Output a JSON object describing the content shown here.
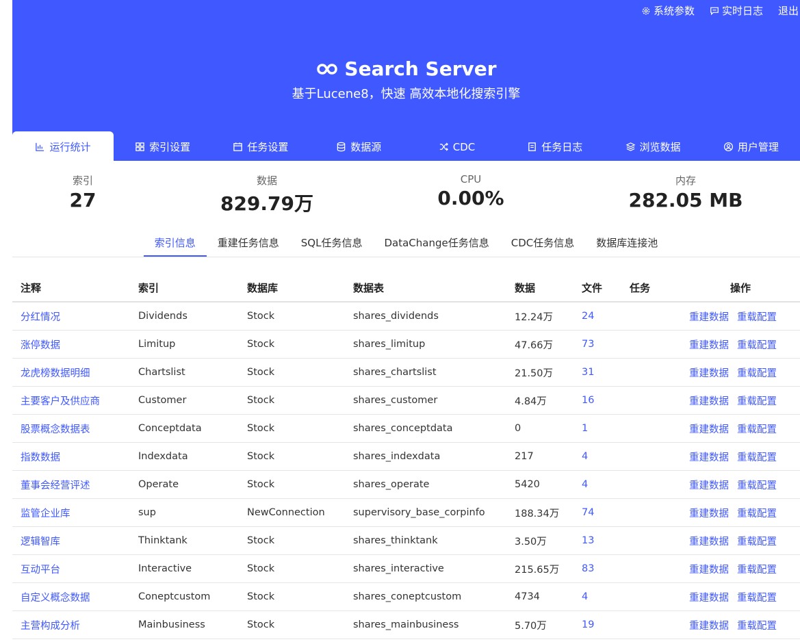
{
  "header": {
    "links": [
      {
        "label": "系统参数",
        "icon": "gear-icon"
      },
      {
        "label": "实时日志",
        "icon": "message-icon"
      },
      {
        "label": "退出"
      }
    ],
    "title": "Search Server",
    "subtitle": "基于Lucene8，快速 高效本地化搜索引擎",
    "accent": "#3f58ff"
  },
  "tabs": [
    {
      "label": "运行统计",
      "icon": "chart-icon"
    },
    {
      "label": "索引设置",
      "icon": "grid-icon"
    },
    {
      "label": "任务设置",
      "icon": "calendar-icon"
    },
    {
      "label": "数据源",
      "icon": "database-icon"
    },
    {
      "label": "CDC",
      "icon": "shuffle-icon"
    },
    {
      "label": "任务日志",
      "icon": "log-icon"
    },
    {
      "label": "浏览数据",
      "icon": "layers-icon"
    },
    {
      "label": "用户管理",
      "icon": "user-icon"
    }
  ],
  "stats": [
    {
      "label": "索引",
      "value": "27"
    },
    {
      "label": "数据",
      "value": "829.79万"
    },
    {
      "label": "CPU",
      "value": "0.00%"
    },
    {
      "label": "内存",
      "value": "282.05 MB"
    }
  ],
  "subtabs": [
    "索引信息",
    "重建任务信息",
    "SQL任务信息",
    "DataChange任务信息",
    "CDC任务信息",
    "数据库连接池"
  ],
  "table": {
    "headers": [
      "注释",
      "索引",
      "数据库",
      "数据表",
      "数据",
      "文件",
      "任务",
      "操作"
    ],
    "action_rebuild": "重建数据",
    "action_reload": "重载配置",
    "rows": [
      {
        "note": "分红情况",
        "index": "Dividends",
        "db": "Stock",
        "table": "shares_dividends",
        "data": "12.24万",
        "files": "24",
        "task": ""
      },
      {
        "note": "涨停数据",
        "index": "Limitup",
        "db": "Stock",
        "table": "shares_limitup",
        "data": "47.66万",
        "files": "73",
        "task": ""
      },
      {
        "note": "龙虎榜数据明细",
        "index": "Chartslist",
        "db": "Stock",
        "table": "shares_chartslist",
        "data": "21.50万",
        "files": "31",
        "task": ""
      },
      {
        "note": "主要客户及供应商",
        "index": "Customer",
        "db": "Stock",
        "table": "shares_customer",
        "data": "4.84万",
        "files": "16",
        "task": ""
      },
      {
        "note": "股票概念数据表",
        "index": "Conceptdata",
        "db": "Stock",
        "table": "shares_conceptdata",
        "data": "0",
        "files": "1",
        "task": ""
      },
      {
        "note": "指数数据",
        "index": "Indexdata",
        "db": "Stock",
        "table": "shares_indexdata",
        "data": "217",
        "files": "4",
        "task": ""
      },
      {
        "note": "董事会经营评述",
        "index": "Operate",
        "db": "Stock",
        "table": "shares_operate",
        "data": "5420",
        "files": "4",
        "task": ""
      },
      {
        "note": "监管企业库",
        "index": "sup",
        "db": "NewConnection",
        "table": "supervisory_base_corpinfo",
        "data": "188.34万",
        "files": "74",
        "task": ""
      },
      {
        "note": "逻辑智库",
        "index": "Thinktank",
        "db": "Stock",
        "table": "shares_thinktank",
        "data": "3.50万",
        "files": "13",
        "task": ""
      },
      {
        "note": "互动平台",
        "index": "Interactive",
        "db": "Stock",
        "table": "shares_interactive",
        "data": "215.65万",
        "files": "83",
        "task": ""
      },
      {
        "note": "自定义概念数据",
        "index": "Coneptcustom",
        "db": "Stock",
        "table": "shares_coneptcustom",
        "data": "4734",
        "files": "4",
        "task": ""
      },
      {
        "note": "主营构成分析",
        "index": "Mainbusiness",
        "db": "Stock",
        "table": "shares_mainbusiness",
        "data": "5.70万",
        "files": "19",
        "task": ""
      }
    ]
  }
}
